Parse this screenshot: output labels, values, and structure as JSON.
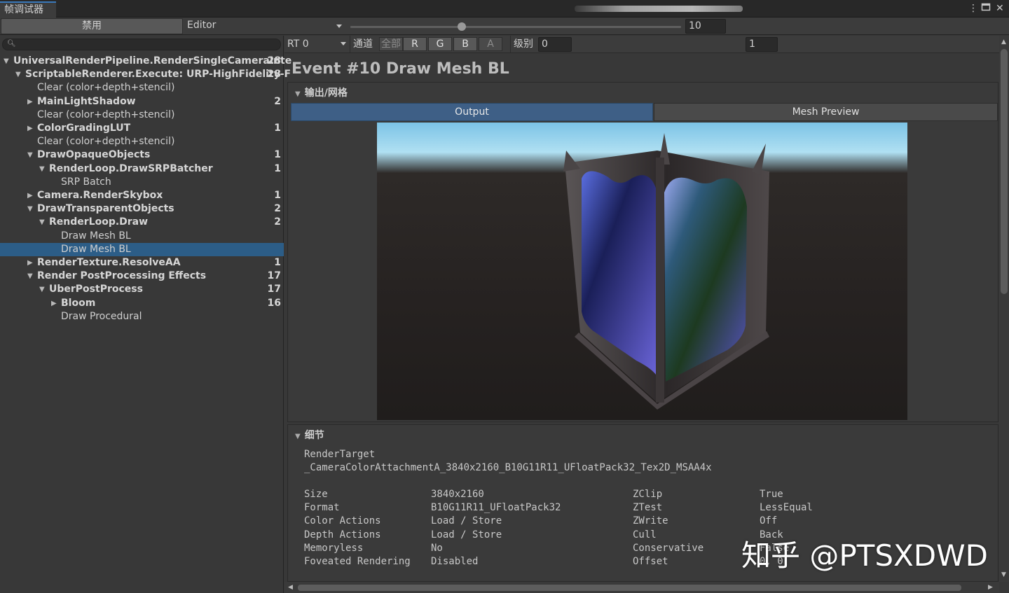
{
  "window": {
    "tab_title": "帧调试器"
  },
  "toolbar": {
    "disable_label": "禁用",
    "target_label": "Editor",
    "frame_value": "10"
  },
  "tree": {
    "rows": [
      {
        "label": "UniversalRenderPipeline.RenderSingleCameraInte",
        "count": "28",
        "bold": true
      },
      {
        "label": "ScriptableRenderer.Execute: URP-HighFidelity-F",
        "count": "28",
        "bold": true
      },
      {
        "label": "Clear (color+depth+stencil)",
        "count": "",
        "bold": false
      },
      {
        "label": "MainLightShadow",
        "count": "2",
        "bold": true
      },
      {
        "label": "Clear (color+depth+stencil)",
        "count": "",
        "bold": false
      },
      {
        "label": "ColorGradingLUT",
        "count": "1",
        "bold": true
      },
      {
        "label": "Clear (color+depth+stencil)",
        "count": "",
        "bold": false
      },
      {
        "label": "DrawOpaqueObjects",
        "count": "1",
        "bold": true
      },
      {
        "label": "RenderLoop.DrawSRPBatcher",
        "count": "1",
        "bold": true
      },
      {
        "label": "SRP Batch",
        "count": "",
        "bold": false
      },
      {
        "label": "Camera.RenderSkybox",
        "count": "1",
        "bold": true
      },
      {
        "label": "DrawTransparentObjects",
        "count": "2",
        "bold": true
      },
      {
        "label": "RenderLoop.Draw",
        "count": "2",
        "bold": true
      },
      {
        "label": "Draw Mesh BL",
        "count": "",
        "bold": false
      },
      {
        "label": "Draw Mesh BL",
        "count": "",
        "bold": false
      },
      {
        "label": "RenderTexture.ResolveAA",
        "count": "1",
        "bold": true
      },
      {
        "label": "Render PostProcessing Effects",
        "count": "17",
        "bold": true
      },
      {
        "label": "UberPostProcess",
        "count": "17",
        "bold": true
      },
      {
        "label": "Bloom",
        "count": "16",
        "bold": true
      },
      {
        "label": "Draw Procedural",
        "count": "",
        "bold": false
      }
    ]
  },
  "rt_toolbar": {
    "rt_label": "RT 0",
    "channel_label": "通道",
    "all_label": "全部",
    "r": "R",
    "g": "G",
    "b": "B",
    "a": "A",
    "level_label": "级别",
    "level_value": "0",
    "mip_value": "1"
  },
  "event": {
    "title": "Event #10 Draw Mesh BL"
  },
  "output": {
    "section_title": "输出/网格",
    "tab_output": "Output",
    "tab_mesh": "Mesh Preview"
  },
  "details": {
    "section_title": "细节",
    "render_target_label": "RenderTarget",
    "render_target_value": "_CameraColorAttachmentA_3840x2160_B10G11R11_UFloatPack32_Tex2D_MSAA4x",
    "left": [
      {
        "key": "Size",
        "value": "3840x2160"
      },
      {
        "key": "Format",
        "value": "B10G11R11_UFloatPack32"
      },
      {
        "key": "Color Actions",
        "value": "Load / Store"
      },
      {
        "key": "Depth Actions",
        "value": "Load / Store"
      },
      {
        "key": "Memoryless",
        "value": "No"
      },
      {
        "key": "Foveated Rendering",
        "value": "Disabled"
      }
    ],
    "right": [
      {
        "key": "ZClip",
        "value": "True"
      },
      {
        "key": "ZTest",
        "value": "LessEqual"
      },
      {
        "key": "ZWrite",
        "value": "Off"
      },
      {
        "key": "Cull",
        "value": "Back"
      },
      {
        "key": "Conservative",
        "value": "False"
      },
      {
        "key": "Offset",
        "value": "0, 0"
      }
    ]
  },
  "watermark": "知乎 @PTSXDWD",
  "colors": {
    "selection": "#2c5d87",
    "accent_tab": "#3e5f86"
  }
}
